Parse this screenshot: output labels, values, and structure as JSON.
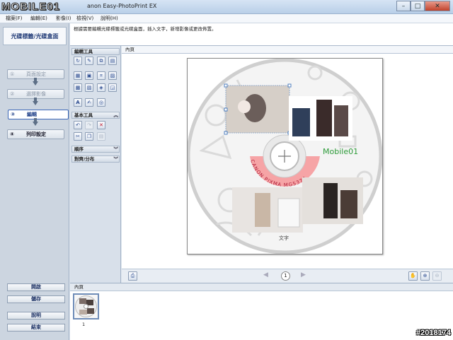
{
  "window": {
    "title": "anon Easy-PhotoPrint EX",
    "buttons": {
      "minimize": "–",
      "maximize": "□",
      "close": "✕"
    }
  },
  "logo_text": "MOBILE01",
  "menu": [
    "檔案(F)",
    "編輯(E)",
    "影像(I)",
    "檢視(V)",
    "說明(H)"
  ],
  "left_panel": {
    "title": "光碟標籤/光碟盒面",
    "steps": [
      {
        "num": "①",
        "label": "頁面設定"
      },
      {
        "num": "②",
        "label": "選擇影像"
      },
      {
        "num": "③",
        "label": "編輯"
      },
      {
        "num": "④",
        "label": "列印設定"
      }
    ],
    "bottom_buttons": [
      "開啟",
      "儲存",
      "說明",
      "結束"
    ]
  },
  "instruction": "根據需要編輯光碟標籤或光碟盒面，插入文字，新增影像或更改佈置。",
  "tools": {
    "edit_header": "編輯工具",
    "basic_header": "基本工具",
    "order_header": "順序",
    "align_header": "對齊/分布"
  },
  "canvas": {
    "label": "內頁",
    "disc_text": "Mobile01",
    "arc_text": "CANON PIXMA MG5370",
    "caption_text": "文字",
    "page_number": "1"
  },
  "thumbnails": {
    "header": "內頁",
    "items": [
      {
        "num": "1"
      }
    ]
  },
  "watermark": "#2018174",
  "colors": {
    "accent": "#3d68b8",
    "disc_text": "#2e9b3a",
    "arc_band": "#f5a3a6"
  }
}
